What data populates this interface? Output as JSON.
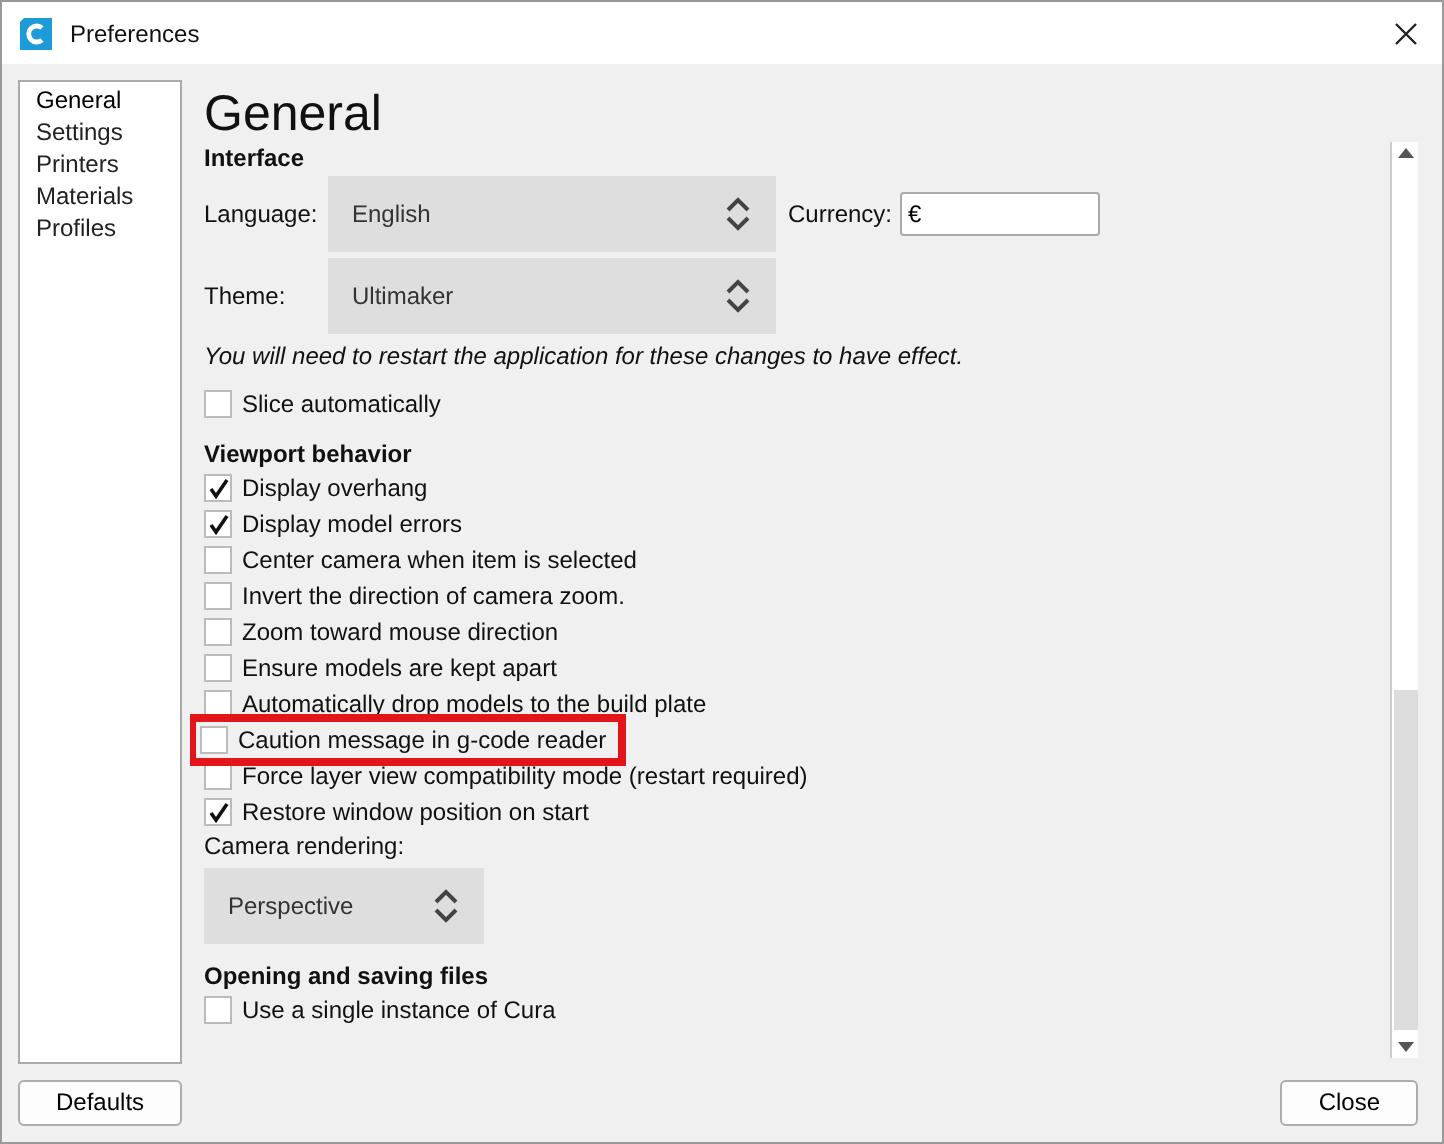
{
  "window": {
    "title": "Preferences"
  },
  "sidebar": {
    "items": [
      {
        "label": "General",
        "selected": true
      },
      {
        "label": "Settings",
        "selected": false
      },
      {
        "label": "Printers",
        "selected": false
      },
      {
        "label": "Materials",
        "selected": false
      },
      {
        "label": "Profiles",
        "selected": false
      }
    ]
  },
  "page_title": "General",
  "interface": {
    "heading": "Interface",
    "language": {
      "label": "Language:",
      "value": "English"
    },
    "currency": {
      "label": "Currency:",
      "value": "€"
    },
    "theme": {
      "label": "Theme:",
      "value": "Ultimaker"
    },
    "note": "You will need to restart the application for these changes to have effect.",
    "slice": {
      "label": "Slice automatically",
      "checked": false
    }
  },
  "viewport": {
    "heading": "Viewport behavior",
    "options": [
      {
        "label": "Display overhang",
        "checked": true,
        "highlighted": false
      },
      {
        "label": "Display model errors",
        "checked": true,
        "highlighted": false
      },
      {
        "label": "Center camera when item is selected",
        "checked": false,
        "highlighted": false
      },
      {
        "label": "Invert the direction of camera zoom.",
        "checked": false,
        "highlighted": false
      },
      {
        "label": "Zoom toward mouse direction",
        "checked": false,
        "highlighted": false
      },
      {
        "label": "Ensure models are kept apart",
        "checked": false,
        "highlighted": false
      },
      {
        "label": "Automatically drop models to the build plate",
        "checked": false,
        "highlighted": false
      },
      {
        "label": "Caution message in g-code reader",
        "checked": false,
        "highlighted": true
      },
      {
        "label": "Force layer view compatibility mode (restart required)",
        "checked": false,
        "highlighted": false
      },
      {
        "label": "Restore window position on start",
        "checked": true,
        "highlighted": false
      }
    ],
    "camera": {
      "label": "Camera rendering:",
      "value": "Perspective"
    }
  },
  "files": {
    "heading": "Opening and saving files",
    "options": [
      {
        "label": "Use a single instance of Cura",
        "checked": false
      }
    ]
  },
  "buttons": {
    "defaults": "Defaults",
    "close": "Close"
  }
}
